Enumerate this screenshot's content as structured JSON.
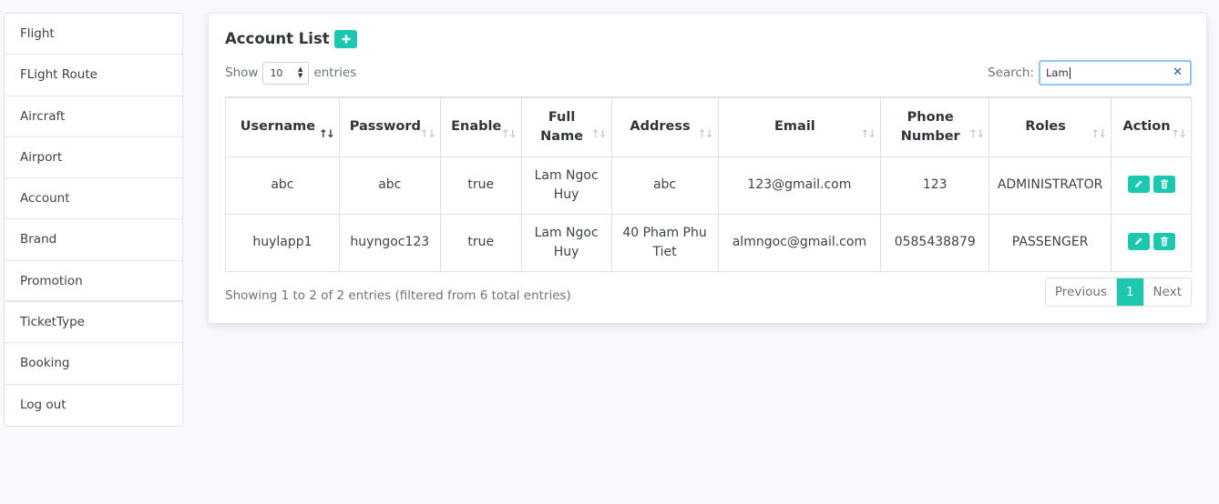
{
  "sidebar": {
    "items": [
      {
        "label": "Flight"
      },
      {
        "label": "FLight Route"
      },
      {
        "label": "Aircraft"
      },
      {
        "label": "Airport"
      },
      {
        "label": "Account"
      },
      {
        "label": "Brand"
      },
      {
        "label": "Promotion"
      },
      {
        "label": "TicketType"
      },
      {
        "label": "Booking"
      },
      {
        "label": "Log out"
      }
    ]
  },
  "card": {
    "title": "Account List",
    "add_icon": "plus-icon"
  },
  "length": {
    "prefix": "Show",
    "value": "10",
    "suffix": "entries"
  },
  "search": {
    "label": "Search:",
    "value": "Lam",
    "clear_icon": "close-icon"
  },
  "table": {
    "columns": [
      {
        "label": "Username",
        "sort": "asc"
      },
      {
        "label": "Password",
        "sort": "none"
      },
      {
        "label": "Enable",
        "sort": "none"
      },
      {
        "label": "Full Name",
        "sort": "none"
      },
      {
        "label": "Address",
        "sort": "none"
      },
      {
        "label": "Email",
        "sort": "none"
      },
      {
        "label": "Phone Number",
        "sort": "none"
      },
      {
        "label": "Roles",
        "sort": "none"
      },
      {
        "label": "Action",
        "sort": "none"
      }
    ],
    "rows": [
      {
        "username": "abc",
        "password": "abc",
        "enable": "true",
        "full_name": "Lam Ngoc Huy",
        "address": "abc",
        "email": "123@gmail.com",
        "phone": "123",
        "roles": "ADMINISTRATOR"
      },
      {
        "username": "huylapp1",
        "password": "huyngoc123",
        "enable": "true",
        "full_name": "Lam Ngoc Huy",
        "address": "40 Pham Phu Tiet",
        "email": "almngoc@gmail.com",
        "phone": "0585438879",
        "roles": "PASSENGER"
      }
    ],
    "action_icons": [
      "edit-icon",
      "trash-icon"
    ]
  },
  "info": "Showing 1 to 2 of 2 entries (filtered from 6 total entries)",
  "pagination": {
    "previous": "Previous",
    "current": "1",
    "next": "Next"
  },
  "colors": {
    "accent": "#1cc7b0",
    "page_bg": "#f8f9fc",
    "search_border": "#8ec5f5"
  }
}
